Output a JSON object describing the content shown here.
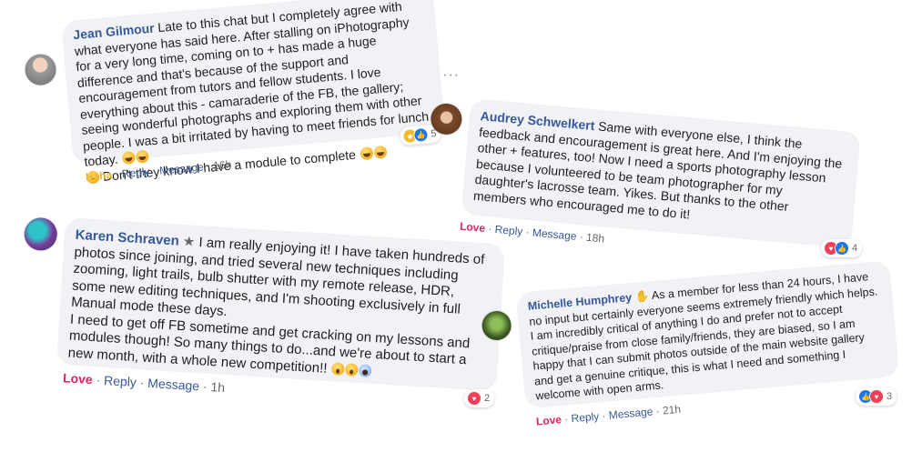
{
  "comments": [
    {
      "name": "Jean Gilmour",
      "text": "Late to this chat but I completely agree with what everyone has said here. After stalling on iPhotography for a very long time, coming on to + has made a huge difference and that's because of the support and encouragement from tutors and fellow students. I love everything about this - camaraderie of the FB, the gallery; seeing wonderful photographs and exploring them with other people. I was a bit irritated by having to meet friends for lunch today.",
      "text2": "Don't they know I have a module to complete",
      "reaction_count": "5",
      "reaction_label": "Haha",
      "reply": "Reply",
      "message": "Message",
      "time": "16h",
      "more": "···"
    },
    {
      "name": "Audrey Schwelkert",
      "text": "Same with everyone else, I think the feedback and encouragement is great here. And I'm enjoying the other + features, too! Now I need a sports photography lesson because I volunteered to be team photographer for my daughter's lacrosse team. Yikes. But thanks to the other members who encouraged me to do it!",
      "reaction_count": "4",
      "reaction_label": "Love",
      "reply": "Reply",
      "message": "Message",
      "time": "18h"
    },
    {
      "name": "Karen Schraven",
      "text": "I am really enjoying it! I have taken hundreds of photos since joining, and tried several new techniques including zooming, light trails, bulb shutter with my remote release, HDR, some new editing techniques, and I'm shooting exclusively in full Manual mode these days.",
      "text2": "I need to get off FB sometime and get cracking on my lessons and modules though! So many things to do...and we're about to start a new month, with a whole new competition!!",
      "reaction_count": "2",
      "reaction_label": "Love",
      "reply": "Reply",
      "message": "Message",
      "time": "1h"
    },
    {
      "name": "Michelle Humphrey",
      "text": "As a member for less than 24 hours, I have no input but certainly everyone seems extremely friendly which helps. I am incredibly critical of anything I do and prefer not to accept critique/praise from close family/friends, they are biased, so I am happy that I can submit photos outside of the main website gallery and get a genuine critique, this is what I need and something I welcome with open arms.",
      "reaction_count": "3",
      "reaction_label": "Love",
      "reply": "Reply",
      "message": "Message",
      "time": "21h"
    }
  ],
  "separator": "·",
  "colors": {
    "bubble": "#f0f2f5",
    "name": "#385898",
    "love": "#e0245e",
    "haha": "#f0b429",
    "like": "#1877f2"
  }
}
